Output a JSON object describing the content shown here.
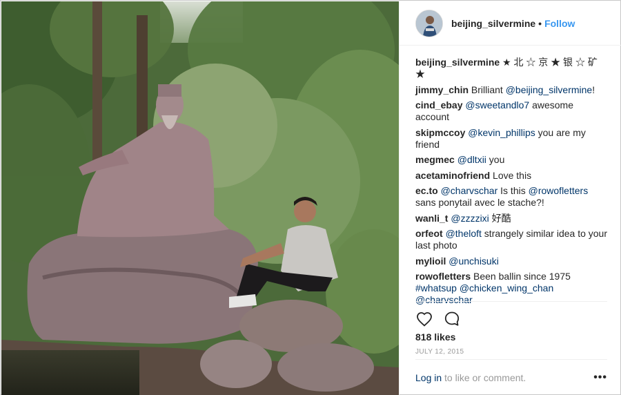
{
  "header": {
    "username": "beijing_silvermine",
    "separator": "•",
    "follow_label": "Follow"
  },
  "comments": [
    {
      "user": "beijing_silvermine",
      "parts": [
        {
          "t": "text",
          "v": " ★ 北 ☆ 京 ★ 银 ☆ 矿 ★"
        }
      ]
    },
    {
      "user": "jimmy_chin",
      "parts": [
        {
          "t": "text",
          "v": " Brilliant "
        },
        {
          "t": "link",
          "v": "@beijing_silvermine"
        },
        {
          "t": "text",
          "v": "!"
        }
      ]
    },
    {
      "user": "cind_ebay",
      "parts": [
        {
          "t": "text",
          "v": " "
        },
        {
          "t": "link",
          "v": "@sweetandlo7"
        },
        {
          "t": "text",
          "v": " awesome account"
        }
      ]
    },
    {
      "user": "skipmccoy",
      "parts": [
        {
          "t": "text",
          "v": " "
        },
        {
          "t": "link",
          "v": "@kevin_phillips"
        },
        {
          "t": "text",
          "v": " you are my friend"
        }
      ]
    },
    {
      "user": "megmec",
      "parts": [
        {
          "t": "text",
          "v": " "
        },
        {
          "t": "link",
          "v": "@dltxii"
        },
        {
          "t": "text",
          "v": " you"
        }
      ]
    },
    {
      "user": "acetaminofriend",
      "parts": [
        {
          "t": "text",
          "v": " Love this"
        }
      ]
    },
    {
      "user": "ec.to",
      "parts": [
        {
          "t": "text",
          "v": " "
        },
        {
          "t": "link",
          "v": "@charvschar"
        },
        {
          "t": "text",
          "v": " Is this "
        },
        {
          "t": "link",
          "v": "@rowofletters"
        },
        {
          "t": "text",
          "v": " sans ponytail avec le stache?!"
        }
      ]
    },
    {
      "user": "wanli_t",
      "parts": [
        {
          "t": "text",
          "v": " "
        },
        {
          "t": "link",
          "v": "@zzzzixi"
        },
        {
          "t": "text",
          "v": " 好酷"
        }
      ]
    },
    {
      "user": "orfeot",
      "parts": [
        {
          "t": "text",
          "v": " "
        },
        {
          "t": "link",
          "v": "@theloft"
        },
        {
          "t": "text",
          "v": " strangely similar idea to your last photo"
        }
      ]
    },
    {
      "user": "mylioil",
      "parts": [
        {
          "t": "text",
          "v": " "
        },
        {
          "t": "link",
          "v": "@unchisuki"
        }
      ]
    },
    {
      "user": "rowofletters",
      "parts": [
        {
          "t": "text",
          "v": " Been ballin since 1975 "
        },
        {
          "t": "link",
          "v": "#whatsup"
        },
        {
          "t": "text",
          "v": " "
        },
        {
          "t": "link",
          "v": "@chicken_wing_chan"
        },
        {
          "t": "text",
          "v": " "
        },
        {
          "t": "link",
          "v": "@charvschar"
        }
      ]
    }
  ],
  "actions": {
    "like_icon": "heart-outline-icon",
    "comment_icon": "speech-bubble-icon"
  },
  "likes_label": "818 likes",
  "date_label": "July 12, 2015",
  "footer": {
    "login_link": "Log in",
    "login_text": " to like or comment.",
    "more_label": "•••"
  },
  "colors": {
    "link": "#003569",
    "follow": "#3897f0",
    "muted": "#999999",
    "border": "#efefef"
  }
}
